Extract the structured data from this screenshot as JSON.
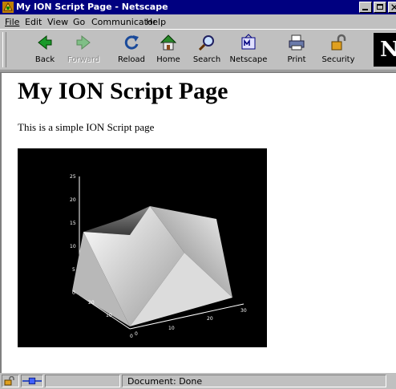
{
  "window": {
    "title": "My ION Script Page - Netscape"
  },
  "menu": {
    "items": [
      "File",
      "Edit",
      "View",
      "Go",
      "Communicator",
      "Help"
    ]
  },
  "toolbar": {
    "buttons": [
      {
        "label": "Back",
        "icon": "back-arrow-icon",
        "enabled": true
      },
      {
        "label": "Forward",
        "icon": "forward-arrow-icon",
        "enabled": false
      },
      {
        "label": "Reload",
        "icon": "reload-icon",
        "enabled": true
      },
      {
        "label": "Home",
        "icon": "home-icon",
        "enabled": true
      },
      {
        "label": "Search",
        "icon": "search-icon",
        "enabled": true
      },
      {
        "label": "Netscape",
        "icon": "netscape-icon",
        "enabled": true
      },
      {
        "label": "Print",
        "icon": "print-icon",
        "enabled": true
      },
      {
        "label": "Security",
        "icon": "security-lock-icon",
        "enabled": true
      }
    ],
    "logo": "N"
  },
  "page": {
    "heading": "My ION Script Page",
    "paragraph": "This is a simple ION Script page"
  },
  "surface_plot": {
    "z_ticks": [
      "25",
      "20",
      "15",
      "10",
      "5",
      "0"
    ],
    "left_axis_ticks": [
      "0",
      "10",
      "20"
    ],
    "right_axis_ticks": [
      "0",
      "10",
      "20",
      "30"
    ]
  },
  "status": {
    "text": "Document: Done"
  },
  "colors": {
    "titlebar": "#000080",
    "chrome": "#c0c0c0",
    "plot_background": "#000000"
  }
}
